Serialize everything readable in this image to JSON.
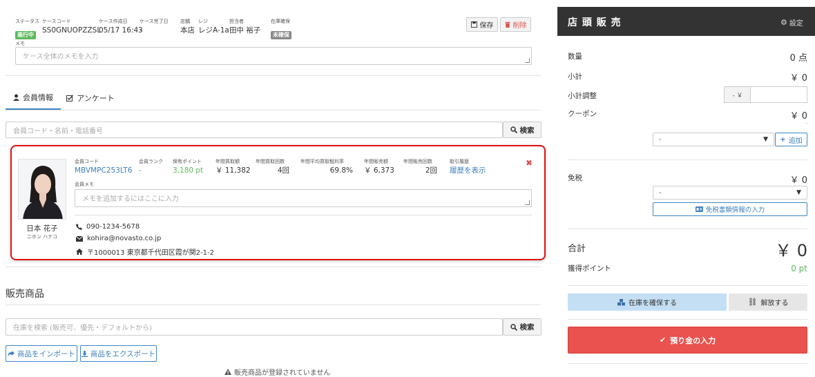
{
  "case": {
    "status": {
      "label": "ステータス",
      "value": "進行中"
    },
    "code": {
      "label": "ケースコード",
      "value": "SS0GNUOPZZSL"
    },
    "created": {
      "label": "ケース作成日",
      "value": "05/17 16:43"
    },
    "completed": {
      "label": "ケース完了日",
      "value": "-"
    },
    "store": {
      "label": "店舗",
      "value": "本店"
    },
    "register": {
      "label": "レジ",
      "value": "レジA-1a"
    },
    "staff": {
      "label": "担当者",
      "value": "田中 裕子"
    },
    "stock": {
      "label": "在庫確保",
      "value": "未確保"
    },
    "save_label": "保存",
    "delete_label": "削除",
    "memo_label": "メモ",
    "memo_placeholder": "ケース全体のメモを入力"
  },
  "tabs": [
    {
      "label": "会員情報",
      "icon": "user-icon",
      "active": true
    },
    {
      "label": "アンケート",
      "icon": "checkbox-icon",
      "active": false
    }
  ],
  "member_search": {
    "placeholder": "会員コード・名前・電話番号",
    "button": "検索"
  },
  "member": {
    "name": "日本 花子",
    "kana": "ニホン ハナコ",
    "stats": [
      {
        "label": "会員コード",
        "value": "MBVMPC253LT6"
      },
      {
        "label": "会員ランク",
        "value": "-"
      },
      {
        "label": "保有ポイント",
        "value": "3,180 pt"
      },
      {
        "label": "年間買取額",
        "value": "￥ 11,382"
      },
      {
        "label": "年間買取回数",
        "value": "4回"
      },
      {
        "label": "年間平均買取粗利率",
        "value": "69.8%"
      },
      {
        "label": "年間販売額",
        "value": "￥ 6,373"
      },
      {
        "label": "年間販売回数",
        "value": "2回"
      },
      {
        "label": "取引履歴",
        "value": "履歴を表示"
      }
    ],
    "memo_label": "会員メモ",
    "memo_placeholder": "メモを追加するにはここに入力",
    "phone": "090-1234-5678",
    "email": "kohira@novasto.co.jp",
    "address": "〒1000013 東京都千代田区霞が関2-1-2"
  },
  "products": {
    "title": "販売商品",
    "search_placeholder": "在庫を検索 (販売可、優先・デフォルトから)",
    "search_button": "検索",
    "import_label": "商品をインポート",
    "export_label": "商品をエクスポート",
    "empty_message": "販売商品が登録されていません"
  },
  "panel": {
    "title": "店 頭 販 売",
    "settings_label": "設定",
    "quantity_label": "数量",
    "quantity_value": "0 点",
    "subtotal_label": "小計",
    "subtotal_value": "￥ 0",
    "adjust_label": "小計調整",
    "adjust_prefix": "- ￥",
    "coupon_label": "クーポン",
    "coupon_value": "￥ 0",
    "coupon_sub": "-",
    "coupon_select": "-",
    "add_label": "追加",
    "tax_free_label": "免税",
    "tax_free_value": "￥ 0",
    "tax_free_select": "-",
    "tax_doc_label": "免税書類情報の入力",
    "total_label": "合計",
    "total_value": "￥ 0",
    "points_label": "獲得ポイント",
    "points_value": "0 pt",
    "reserve_label": "在庫を確保する",
    "release_label": "解放する",
    "deposit_label": "預り金の入力"
  },
  "colors": {
    "accent": "#3d85c6",
    "danger": "#e9524f",
    "success": "#5cb85c",
    "dark": "#333333",
    "highlight": "#e11111"
  }
}
